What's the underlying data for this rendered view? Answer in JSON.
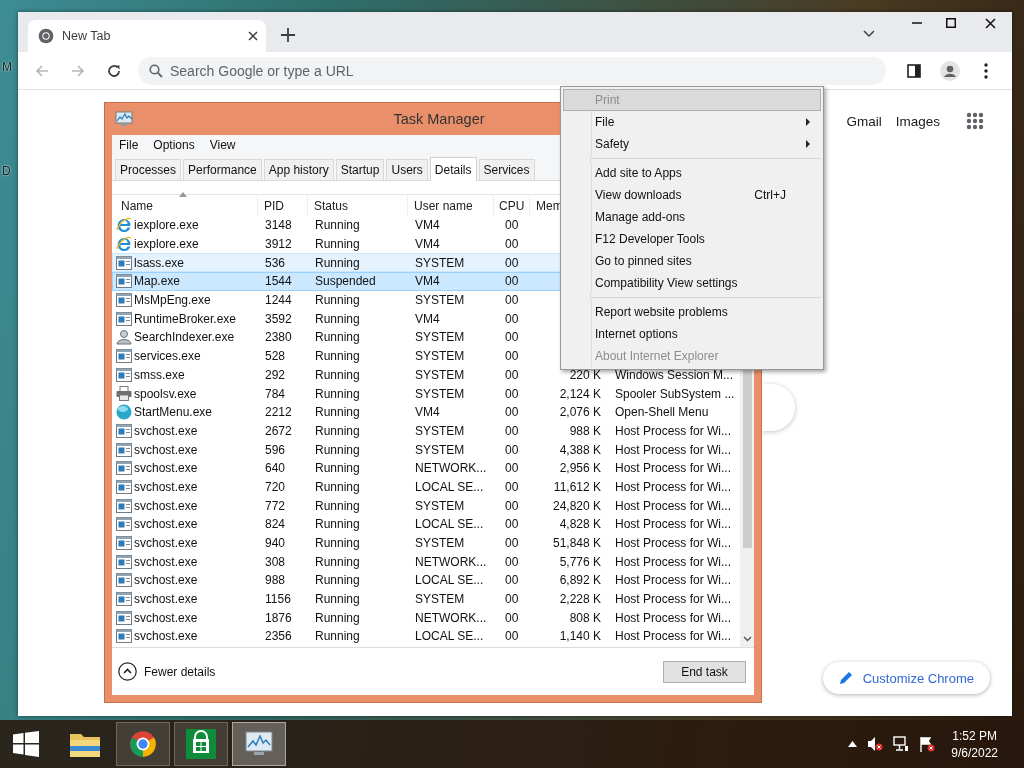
{
  "desktop": {
    "labels": [
      "M",
      "D"
    ]
  },
  "browser": {
    "tabs": [
      {
        "title": "New Tab",
        "selected": true
      }
    ],
    "nav": [
      {
        "kind": "back",
        "disabled": true
      },
      {
        "kind": "forward",
        "disabled": true
      },
      {
        "kind": "reload",
        "disabled": false
      }
    ],
    "omnibox": {
      "placeholder": "Search Google or type a URL"
    },
    "links": [
      "Gmail",
      "Images"
    ],
    "customize_button": "Customize Chrome"
  },
  "task_manager": {
    "title": "Task Manager",
    "menu": [
      "File",
      "Options",
      "View"
    ],
    "tabs": [
      {
        "label": "Processes",
        "selected": false
      },
      {
        "label": "Performance",
        "selected": false
      },
      {
        "label": "App history",
        "selected": false
      },
      {
        "label": "Startup",
        "selected": false
      },
      {
        "label": "Users",
        "selected": false
      },
      {
        "label": "Details",
        "selected": true
      },
      {
        "label": "Services",
        "selected": false
      }
    ],
    "columns": [
      "Name",
      "PID",
      "Status",
      "User name",
      "CPU",
      "Mem"
    ],
    "rows": [
      {
        "kind": "ie",
        "name": "iexplore.exe",
        "pid": "3148",
        "status": "Running",
        "user": "VM4",
        "cpu": "00",
        "selected": false,
        "hovered": false
      },
      {
        "kind": "ie",
        "name": "iexplore.exe",
        "pid": "3912",
        "status": "Running",
        "user": "VM4",
        "cpu": "00",
        "selected": false,
        "hovered": false
      },
      {
        "kind": "app",
        "name": "lsass.exe",
        "pid": "536",
        "status": "Running",
        "user": "SYSTEM",
        "cpu": "00",
        "selected": false,
        "hovered": true
      },
      {
        "kind": "app",
        "name": "Map.exe",
        "pid": "1544",
        "status": "Suspended",
        "user": "VM4",
        "cpu": "00",
        "selected": true,
        "hovered": false
      },
      {
        "kind": "app",
        "name": "MsMpEng.exe",
        "pid": "1244",
        "status": "Running",
        "user": "SYSTEM",
        "cpu": "00",
        "selected": false,
        "hovered": false
      },
      {
        "kind": "app",
        "name": "RuntimeBroker.exe",
        "pid": "3592",
        "status": "Running",
        "user": "VM4",
        "cpu": "00",
        "selected": false,
        "hovered": false
      },
      {
        "kind": "user",
        "name": "SearchIndexer.exe",
        "pid": "2380",
        "status": "Running",
        "user": "SYSTEM",
        "cpu": "00",
        "selected": false,
        "hovered": false
      },
      {
        "kind": "app",
        "name": "services.exe",
        "pid": "528",
        "status": "Running",
        "user": "SYSTEM",
        "cpu": "00",
        "selected": false,
        "hovered": false
      },
      {
        "kind": "app",
        "name": "smss.exe",
        "pid": "292",
        "status": "Running",
        "user": "SYSTEM",
        "cpu": "00",
        "memory": "220 K",
        "description": "Windows Session M...",
        "selected": false,
        "hovered": false
      },
      {
        "kind": "printer",
        "name": "spoolsv.exe",
        "pid": "784",
        "status": "Running",
        "user": "SYSTEM",
        "cpu": "00",
        "memory": "2,124 K",
        "description": "Spooler SubSystem ...",
        "selected": false,
        "hovered": false
      },
      {
        "kind": "globe",
        "name": "StartMenu.exe",
        "pid": "2212",
        "status": "Running",
        "user": "VM4",
        "cpu": "00",
        "memory": "2,076 K",
        "description": "Open-Shell Menu",
        "selected": false,
        "hovered": false
      },
      {
        "kind": "app",
        "name": "svchost.exe",
        "pid": "2672",
        "status": "Running",
        "user": "SYSTEM",
        "cpu": "00",
        "memory": "988 K",
        "description": "Host Process for Wi...",
        "selected": false,
        "hovered": false
      },
      {
        "kind": "app",
        "name": "svchost.exe",
        "pid": "596",
        "status": "Running",
        "user": "SYSTEM",
        "cpu": "00",
        "memory": "4,388 K",
        "description": "Host Process for Wi...",
        "selected": false,
        "hovered": false
      },
      {
        "kind": "app",
        "name": "svchost.exe",
        "pid": "640",
        "status": "Running",
        "user": "NETWORK...",
        "cpu": "00",
        "memory": "2,956 K",
        "description": "Host Process for Wi...",
        "selected": false,
        "hovered": false
      },
      {
        "kind": "app",
        "name": "svchost.exe",
        "pid": "720",
        "status": "Running",
        "user": "LOCAL SE...",
        "cpu": "00",
        "memory": "11,612 K",
        "description": "Host Process for Wi...",
        "selected": false,
        "hovered": false
      },
      {
        "kind": "app",
        "name": "svchost.exe",
        "pid": "772",
        "status": "Running",
        "user": "SYSTEM",
        "cpu": "00",
        "memory": "24,820 K",
        "description": "Host Process for Wi...",
        "selected": false,
        "hovered": false
      },
      {
        "kind": "app",
        "name": "svchost.exe",
        "pid": "824",
        "status": "Running",
        "user": "LOCAL SE...",
        "cpu": "00",
        "memory": "4,828 K",
        "description": "Host Process for Wi...",
        "selected": false,
        "hovered": false
      },
      {
        "kind": "app",
        "name": "svchost.exe",
        "pid": "940",
        "status": "Running",
        "user": "SYSTEM",
        "cpu": "00",
        "memory": "51,848 K",
        "description": "Host Process for Wi...",
        "selected": false,
        "hovered": false
      },
      {
        "kind": "app",
        "name": "svchost.exe",
        "pid": "308",
        "status": "Running",
        "user": "NETWORK...",
        "cpu": "00",
        "memory": "5,776 K",
        "description": "Host Process for Wi...",
        "selected": false,
        "hovered": false
      },
      {
        "kind": "app",
        "name": "svchost.exe",
        "pid": "988",
        "status": "Running",
        "user": "LOCAL SE...",
        "cpu": "00",
        "memory": "6,892 K",
        "description": "Host Process for Wi...",
        "selected": false,
        "hovered": false
      },
      {
        "kind": "app",
        "name": "svchost.exe",
        "pid": "1156",
        "status": "Running",
        "user": "SYSTEM",
        "cpu": "00",
        "memory": "2,228 K",
        "description": "Host Process for Wi...",
        "selected": false,
        "hovered": false
      },
      {
        "kind": "app",
        "name": "svchost.exe",
        "pid": "1876",
        "status": "Running",
        "user": "NETWORK...",
        "cpu": "00",
        "memory": "808 K",
        "description": "Host Process for Wi...",
        "selected": false,
        "hovered": false
      },
      {
        "kind": "app",
        "name": "svchost.exe",
        "pid": "2356",
        "status": "Running",
        "user": "LOCAL SE...",
        "cpu": "00",
        "memory": "1,140 K",
        "description": "Host Process for Wi...",
        "selected": false,
        "hovered": false
      }
    ],
    "footer": {
      "toggle": "Fewer details",
      "button": "End task"
    }
  },
  "context_menu": {
    "items": [
      {
        "kind": "item",
        "label": "Print",
        "disabled": true,
        "highlighted": true,
        "submenu": false
      },
      {
        "kind": "item",
        "label": "File",
        "disabled": false,
        "highlighted": false,
        "submenu": true
      },
      {
        "kind": "item",
        "label": "Safety",
        "disabled": false,
        "highlighted": false,
        "submenu": true
      },
      {
        "kind": "separator"
      },
      {
        "kind": "item",
        "label": "Add site to Apps",
        "disabled": false,
        "highlighted": false,
        "submenu": false
      },
      {
        "kind": "item",
        "label": "View downloads",
        "shortcut": "Ctrl+J",
        "disabled": false,
        "highlighted": false,
        "submenu": false
      },
      {
        "kind": "item",
        "label": "Manage add-ons",
        "disabled": false,
        "highlighted": false,
        "submenu": false
      },
      {
        "kind": "item",
        "label": "F12 Developer Tools",
        "disabled": false,
        "highlighted": false,
        "submenu": false
      },
      {
        "kind": "item",
        "label": "Go to pinned sites",
        "disabled": false,
        "highlighted": false,
        "submenu": false
      },
      {
        "kind": "item",
        "label": "Compatibility View settings",
        "disabled": false,
        "highlighted": false,
        "submenu": false
      },
      {
        "kind": "separator"
      },
      {
        "kind": "item",
        "label": "Report website problems",
        "disabled": false,
        "highlighted": false,
        "submenu": false
      },
      {
        "kind": "item",
        "label": "Internet options",
        "disabled": false,
        "highlighted": false,
        "submenu": false
      },
      {
        "kind": "item",
        "label": "About Internet Explorer",
        "disabled": true,
        "highlighted": false,
        "submenu": false
      }
    ]
  },
  "taskbar": {
    "apps": [
      {
        "kind": "explorer",
        "running": false,
        "selected": false
      },
      {
        "kind": "chrome",
        "running": true,
        "selected": false
      },
      {
        "kind": "store",
        "running": true,
        "selected": false
      },
      {
        "kind": "taskmgr",
        "running": true,
        "selected": true
      }
    ],
    "tray": [
      {
        "kind": "show-hidden"
      },
      {
        "kind": "volume-muted"
      },
      {
        "kind": "network"
      },
      {
        "kind": "action-center"
      }
    ],
    "clock": {
      "time": "1:52 PM",
      "date": "9/6/2022"
    }
  }
}
